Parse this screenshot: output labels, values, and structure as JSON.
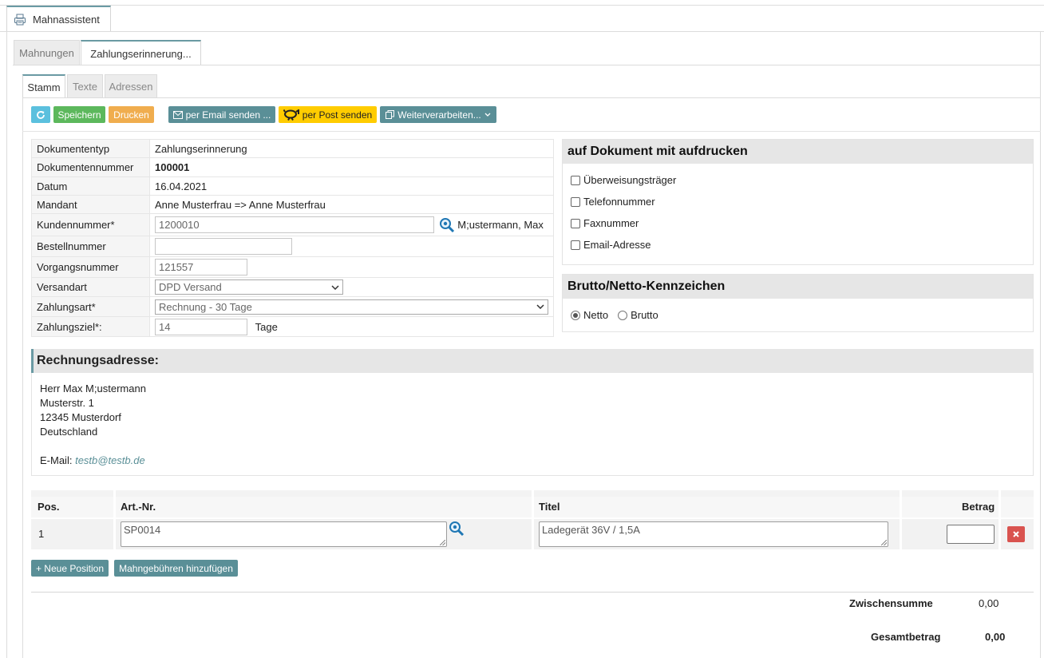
{
  "window": {
    "tab_title": "Mahnassistent",
    "tab_icon": "printer-icon"
  },
  "subtabs": [
    {
      "label": "Mahnungen",
      "active": false
    },
    {
      "label": "Zahlungserinnerung...",
      "active": true
    }
  ],
  "tabs": [
    {
      "label": "Stamm",
      "active": true
    },
    {
      "label": "Texte",
      "active": false
    },
    {
      "label": "Adressen",
      "active": false
    }
  ],
  "toolbar": {
    "refresh_icon": "refresh-icon",
    "save_label": "Speichern",
    "print_label": "Drucken",
    "email_label": "per Email senden ...",
    "post_label": "per Post senden",
    "process_label": "Weiterverarbeiten...",
    "colors": {
      "refresh": "#5bc0de",
      "save": "#5cb85c",
      "print": "#f0ad4e",
      "email": "#5a8f97",
      "post": "#ffcc00",
      "process": "#5a8f97"
    }
  },
  "form": {
    "dokumententyp": {
      "label": "Dokumententyp",
      "value": "Zahlungserinnerung"
    },
    "dokumentennummer": {
      "label": "Dokumentennummer",
      "value": "100001"
    },
    "datum": {
      "label": "Datum",
      "value": "16.04.2021"
    },
    "mandant": {
      "label": "Mandant",
      "value": "Anne Musterfrau => Anne Musterfrau"
    },
    "kundennummer": {
      "label": "Kundennummer*",
      "value": "1200010",
      "customer_name": "M;ustermann, Max"
    },
    "bestellnummer": {
      "label": "Bestellnummer",
      "value": ""
    },
    "vorgangsnummer": {
      "label": "Vorgangsnummer",
      "value": "121557"
    },
    "versandart": {
      "label": "Versandart",
      "value": "DPD Versand"
    },
    "zahlungsart": {
      "label": "Zahlungsart*",
      "value": "Rechnung - 30 Tage"
    },
    "zahlungsziel": {
      "label": "Zahlungsziel*:",
      "value": "14",
      "unit": "Tage"
    }
  },
  "print_options": {
    "title": "auf Dokument mit aufdrucken",
    "items": [
      {
        "label": "Überweisungsträger",
        "checked": false
      },
      {
        "label": "Telefonnummer",
        "checked": false
      },
      {
        "label": "Faxnummer",
        "checked": false
      },
      {
        "label": "Email-Adresse",
        "checked": false
      }
    ]
  },
  "brutto_netto": {
    "title": "Brutto/Netto-Kennzeichen",
    "options": [
      {
        "label": "Netto",
        "selected": true
      },
      {
        "label": "Brutto",
        "selected": false
      }
    ]
  },
  "address": {
    "title": "Rechnungsadresse:",
    "lines": [
      "Herr Max M;ustermann",
      "Musterstr. 1",
      "12345 Musterdorf",
      "Deutschland"
    ],
    "email_label": "E-Mail:",
    "email": "testb@testb.de"
  },
  "positions": {
    "headers": {
      "pos": "Pos.",
      "art": "Art.-Nr.",
      "title": "Titel",
      "amount": "Betrag"
    },
    "rows": [
      {
        "pos": "1",
        "art_nr": "SP0014",
        "title": "Ladegerät 36V / 1,5A",
        "amount": ""
      }
    ],
    "add_position_label": "+ Neue Position",
    "add_fees_label": "Mahngebühren hinzufügen"
  },
  "totals": {
    "subtotal_label": "Zwischensumme",
    "subtotal_value": "0,00",
    "total_label": "Gesamtbetrag",
    "total_value": "0,00"
  }
}
